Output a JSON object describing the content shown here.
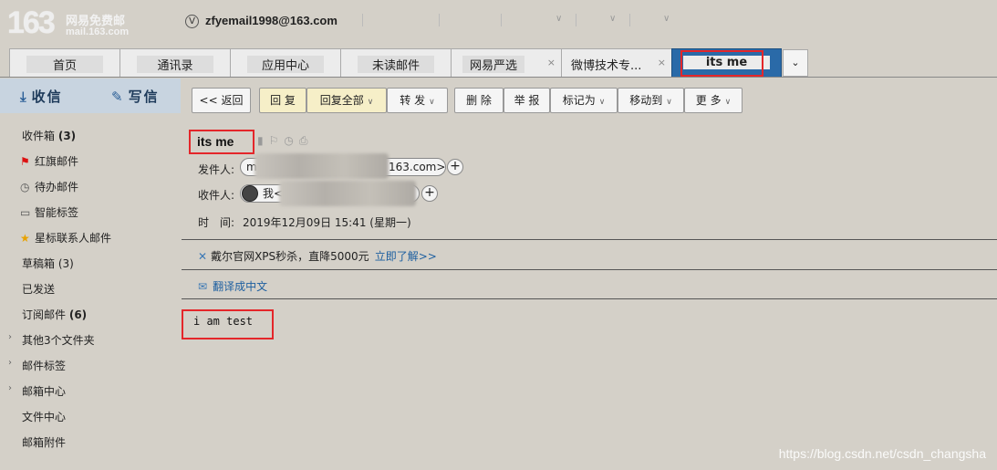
{
  "brand": {
    "number": "163",
    "line1": "网易免费邮",
    "line2": "mail.163.com"
  },
  "account": {
    "badge": "V",
    "email": "zfyemail1998@163.com"
  },
  "tabs": [
    {
      "label": "首页"
    },
    {
      "label": "通讯录"
    },
    {
      "label": "应用中心"
    },
    {
      "label": "未读邮件"
    },
    {
      "label": "网易严选",
      "close": "×"
    },
    {
      "label": "微博技术专...",
      "close": "×"
    },
    {
      "label": "its me",
      "close": "×"
    }
  ],
  "tab_more": "⌄",
  "compose": {
    "receive": "收信",
    "write": "写信"
  },
  "folders": [
    {
      "label": "收件箱",
      "count": "(3)"
    },
    {
      "label": "红旗邮件"
    },
    {
      "label": "待办邮件"
    },
    {
      "label": "智能标签"
    },
    {
      "label": "星标联系人邮件"
    },
    {
      "label": "草稿箱 (3)"
    },
    {
      "label": "已发送"
    },
    {
      "label": "订阅邮件",
      "count": "(6)"
    },
    {
      "label": "其他3个文件夹"
    },
    {
      "label": "邮件标签"
    },
    {
      "label": "邮箱中心"
    },
    {
      "label": "文件中心"
    },
    {
      "label": "邮箱附件"
    }
  ],
  "toolbar": {
    "back": "<< 返回",
    "reply": "回 复",
    "reply_all": "回复全部",
    "forward": "转 发",
    "delete": "删 除",
    "report": "举 报",
    "mark": "标记为",
    "move": "移动到",
    "more": "更 多",
    "dropdown": "∨"
  },
  "mail": {
    "subject": "its me",
    "from_label": "发件人:",
    "from_prefix": "m",
    "from_suffix": "163.com>",
    "to_label": "收件人:",
    "to_value": "我<",
    "time_label": "时　间:",
    "time_value": "2019年12月09日 15:41 (星期一)",
    "plus": "+",
    "body": "i am test"
  },
  "ad": {
    "text": "戴尔官网XPS秒杀，直降5000元",
    "link": "立即了解>>"
  },
  "translate": "翻译成中文",
  "watermark": "https://blog.csdn.net/csdn_changsha",
  "colors": {
    "highlight": "#e4262a",
    "active_tab": "#2a6aa8",
    "link": "#1d5fa0"
  }
}
